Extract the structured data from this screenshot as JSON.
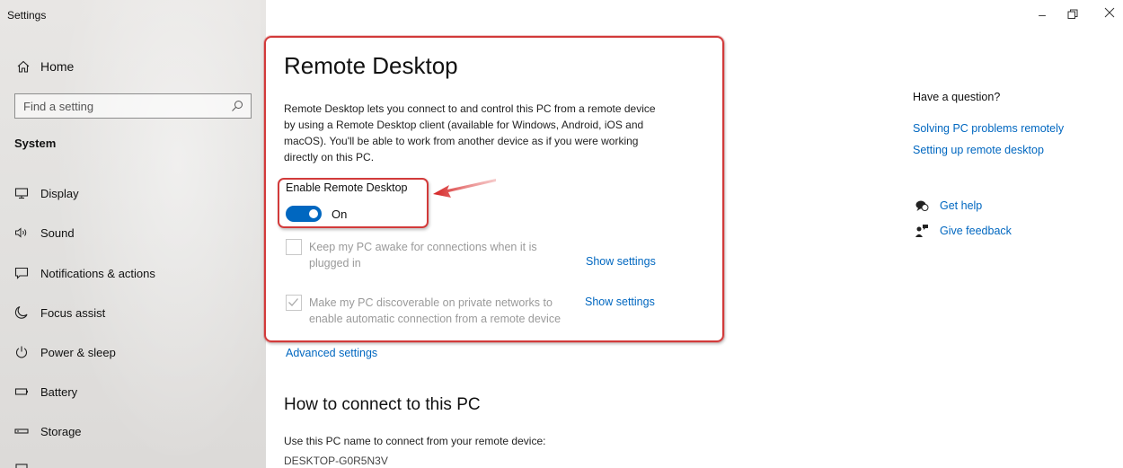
{
  "app": {
    "title": "Settings"
  },
  "sidebar": {
    "home": {
      "label": "Home",
      "icon": "home-icon"
    },
    "search": {
      "placeholder": "Find a setting",
      "icon": "search-icon"
    },
    "section": "System",
    "items": [
      {
        "label": "Display",
        "icon": "display-icon"
      },
      {
        "label": "Sound",
        "icon": "sound-icon"
      },
      {
        "label": "Notifications & actions",
        "icon": "notifications-icon"
      },
      {
        "label": "Focus assist",
        "icon": "focus-assist-icon"
      },
      {
        "label": "Power & sleep",
        "icon": "power-icon"
      },
      {
        "label": "Battery",
        "icon": "battery-icon"
      },
      {
        "label": "Storage",
        "icon": "storage-icon"
      }
    ]
  },
  "window_controls": {
    "minimize": "–",
    "restore": "🗗",
    "close": "✕"
  },
  "main": {
    "title": "Remote Desktop",
    "description": "Remote Desktop lets you connect to and control this PC from a remote device by using a Remote Desktop client (available for Windows, Android, iOS and macOS). You'll be able to work from another device as if you were working directly on this PC.",
    "enable": {
      "label": "Enable Remote Desktop",
      "state": "On",
      "on": true,
      "accent": "#0067c0"
    },
    "options": [
      {
        "text": "Keep my PC awake for connections when it is plugged in",
        "checked": false,
        "link": "Show settings"
      },
      {
        "text": "Make my PC discoverable on private networks to enable automatic connection from a remote device",
        "checked": true,
        "link": "Show settings"
      }
    ],
    "advanced_link": "Advanced settings",
    "connect": {
      "title": "How to connect to this PC",
      "instruction": "Use this PC name to connect from your remote device:",
      "pc_name": "DESKTOP-G0R5N3V"
    }
  },
  "related": {
    "question": "Have a question?",
    "links": [
      "Solving PC problems remotely",
      "Setting up remote desktop"
    ],
    "help": {
      "get_help": "Get help",
      "give_feedback": "Give feedback"
    }
  },
  "colors": {
    "accent": "#0067c0",
    "highlight": "#d23a3a"
  }
}
